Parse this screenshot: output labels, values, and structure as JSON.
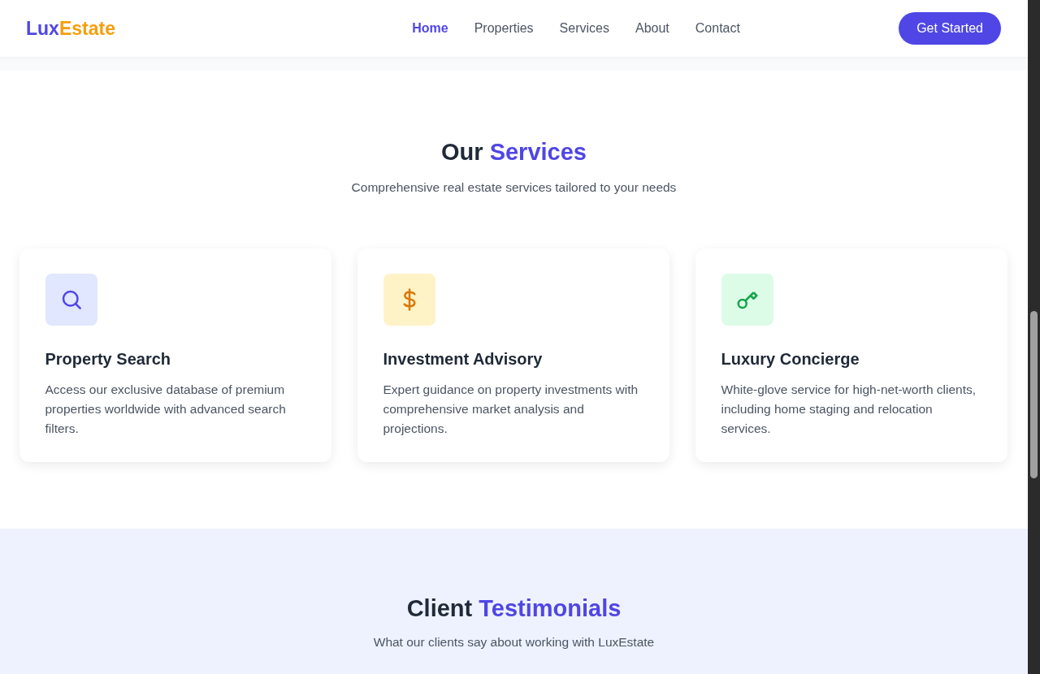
{
  "header": {
    "logo": {
      "lead": "Lux",
      "accent": "Estate"
    },
    "nav": [
      {
        "label": "Home",
        "selected": true
      },
      {
        "label": "Properties",
        "selected": false
      },
      {
        "label": "Services",
        "selected": false
      },
      {
        "label": "About",
        "selected": false
      },
      {
        "label": "Contact",
        "selected": false
      }
    ],
    "cta": "Get Started"
  },
  "services": {
    "title": "Our",
    "title_accent": "Services",
    "subtitle": "Comprehensive real estate services tailored to your needs",
    "cards": [
      {
        "title": "Property Search",
        "text": "Access our exclusive database of premium properties worldwide with advanced search filters."
      },
      {
        "title": "Investment Advisory",
        "text": "Expert guidance on property investments with comprehensive market analysis and projections."
      },
      {
        "title": "Luxury Concierge",
        "text": "White-glove service for high-net-worth clients, including home staging and relocation services."
      }
    ]
  },
  "testimonials": {
    "title": "Client",
    "title_accent": "Testimonials",
    "subtitle": "What our clients say about working with LuxEstate"
  }
}
